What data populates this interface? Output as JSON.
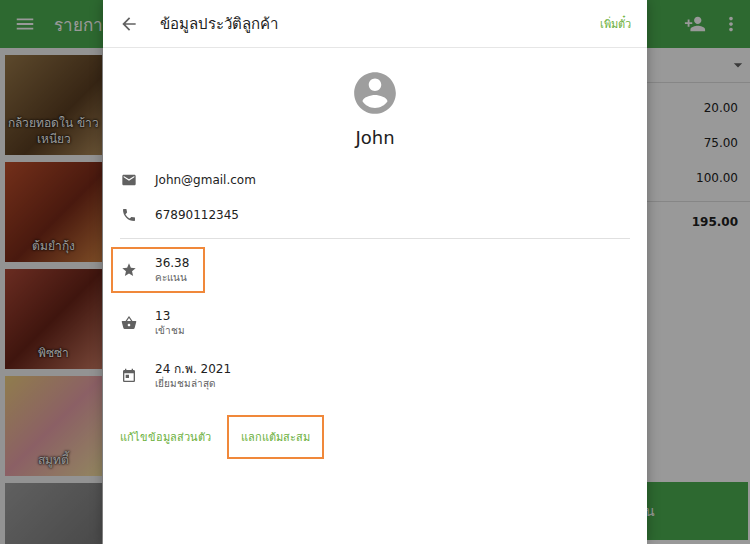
{
  "app": {
    "title": "รายการ",
    "menu_items": [
      {
        "label": "กล้วยทอดใน ข้าวเหนียว"
      },
      {
        "label": "ต้มยำกุ้ง"
      },
      {
        "label": "พิซซ่า"
      },
      {
        "label": "สมูทตี้"
      }
    ],
    "order": {
      "prices": [
        "20.00",
        "75.00",
        "100.00"
      ],
      "total": "195.00"
    },
    "action_button": "น"
  },
  "dialog": {
    "title": "ข้อมูลประวัติลูกค้า",
    "action": "เพิ่มตั๋ว",
    "customer": {
      "name": "John",
      "email": "John@gmail.com",
      "phone": "67890112345"
    },
    "stats": [
      {
        "value": "36.38",
        "label": "คะแนน",
        "highlighted": true
      },
      {
        "value": "13",
        "label": "เข้าชม",
        "highlighted": false
      },
      {
        "value": "24 ก.พ. 2021",
        "label": "เยี่ยมชมล่าสุด",
        "highlighted": false
      }
    ],
    "buttons": [
      {
        "label": "แก้ไขข้อมูลส่วนตัว",
        "highlighted": false
      },
      {
        "label": "แลกแต้มสะสม",
        "highlighted": true
      }
    ]
  }
}
